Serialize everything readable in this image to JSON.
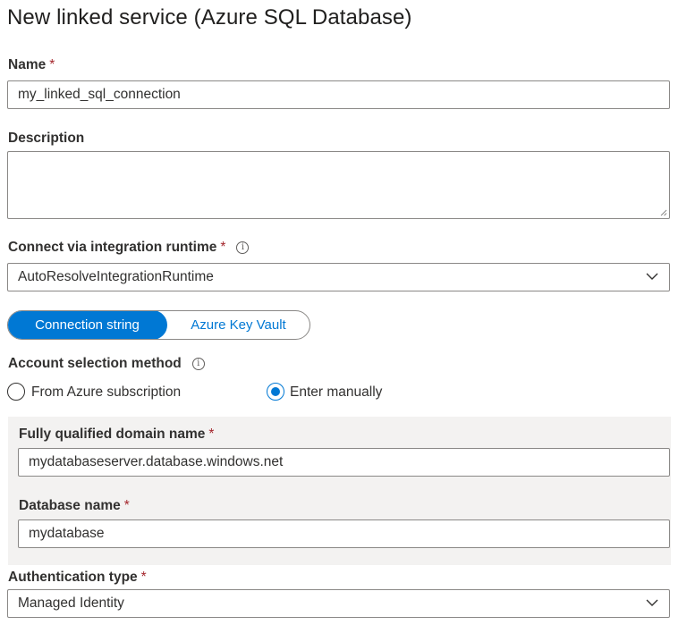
{
  "dialog": {
    "title": "New linked service (Azure SQL Database)"
  },
  "fields": {
    "name": {
      "label": "Name",
      "required_mark": "*",
      "value": "my_linked_sql_connection"
    },
    "description": {
      "label": "Description",
      "value": ""
    },
    "integration_runtime": {
      "label": "Connect via integration runtime",
      "required_mark": "*",
      "selected": "AutoResolveIntegrationRuntime",
      "info_icon": "info-icon"
    },
    "connection_toggle": {
      "options": [
        "Connection string",
        "Azure Key Vault"
      ],
      "active": "Connection string"
    },
    "account_selection": {
      "label": "Account selection method",
      "info_icon": "info-icon",
      "options": [
        {
          "label": "From Azure subscription",
          "checked": false
        },
        {
          "label": "Enter manually",
          "checked": true
        }
      ]
    },
    "fqdn": {
      "label": "Fully qualified domain name",
      "required_mark": "*",
      "value": "mydatabaseserver.database.windows.net"
    },
    "database_name": {
      "label": "Database name",
      "required_mark": "*",
      "value": "mydatabase"
    },
    "authentication_type": {
      "label": "Authentication type",
      "required_mark": "*",
      "selected": "Managed Identity"
    }
  },
  "colors": {
    "accent": "#0078d4",
    "required": "#a4262c",
    "panel_bg": "#f3f2f1",
    "border": "#8a8886"
  }
}
